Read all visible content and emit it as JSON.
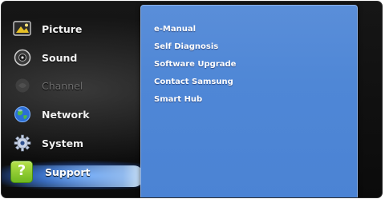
{
  "menu": {
    "items": [
      {
        "label": "Picture",
        "icon": "picture-icon",
        "enabled": true
      },
      {
        "label": "Sound",
        "icon": "sound-icon",
        "enabled": true
      },
      {
        "label": "Channel",
        "icon": "channel-icon",
        "enabled": false
      },
      {
        "label": "Network",
        "icon": "network-globe-icon",
        "enabled": true
      },
      {
        "label": "System",
        "icon": "system-gear-icon",
        "enabled": true
      },
      {
        "label": "Support",
        "icon": "support-question-icon",
        "enabled": true,
        "selected": true
      }
    ],
    "support_icon_glyph": "?"
  },
  "submenu": {
    "items": [
      {
        "label": "e-Manual"
      },
      {
        "label": "Self Diagnosis"
      },
      {
        "label": "Software Upgrade"
      },
      {
        "label": "Contact Samsung"
      },
      {
        "label": "Smart Hub"
      }
    ]
  },
  "colors": {
    "submenu_bg": "#4f87d6",
    "selection_glow": "#5aa0ff",
    "support_icon_green": "#8fcb2f"
  }
}
